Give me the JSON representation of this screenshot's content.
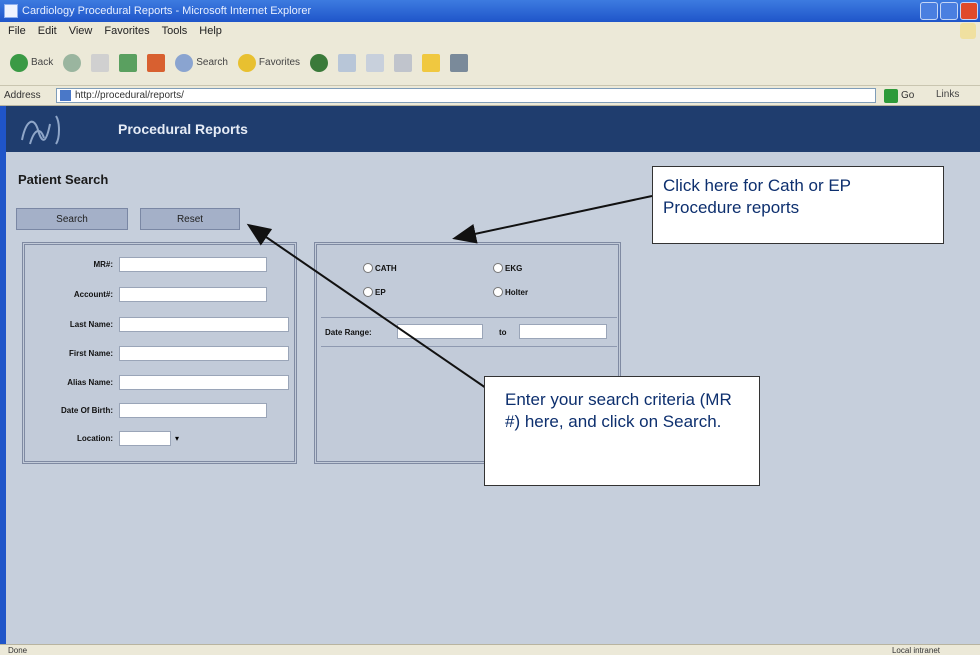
{
  "window": {
    "title": "Cardiology Procedural Reports - Microsoft Internet Explorer"
  },
  "menu": [
    "File",
    "Edit",
    "View",
    "Favorites",
    "Tools",
    "Help"
  ],
  "toolbar": {
    "back_label": "Back",
    "search_label": "Search",
    "favorites_label": "Favorites"
  },
  "address": {
    "label": "Address",
    "url": "http://procedural/reports/",
    "go_label": "Go",
    "links_label": "Links"
  },
  "app": {
    "title": "Procedural Reports"
  },
  "page": {
    "title": "Patient Search",
    "search_button": "Search",
    "reset_button": "Reset"
  },
  "form": {
    "fields": [
      {
        "label": "MR#:"
      },
      {
        "label": "Account#:"
      },
      {
        "label": "Last Name:"
      },
      {
        "label": "First Name:"
      },
      {
        "label": "Alias Name:"
      },
      {
        "label": "Date Of Birth:"
      },
      {
        "label": "Location:"
      }
    ],
    "location_select": ""
  },
  "report_types": [
    "CATH",
    "EKG",
    "EP",
    "Holter"
  ],
  "date_range": {
    "label": "Date Range:",
    "to_label": "to"
  },
  "callouts": {
    "top": "Click here for Cath or EP Procedure reports",
    "middle": "Enter your search criteria (MR #) here, and click on Search."
  },
  "status": {
    "left": "Done",
    "right": "Local intranet"
  }
}
